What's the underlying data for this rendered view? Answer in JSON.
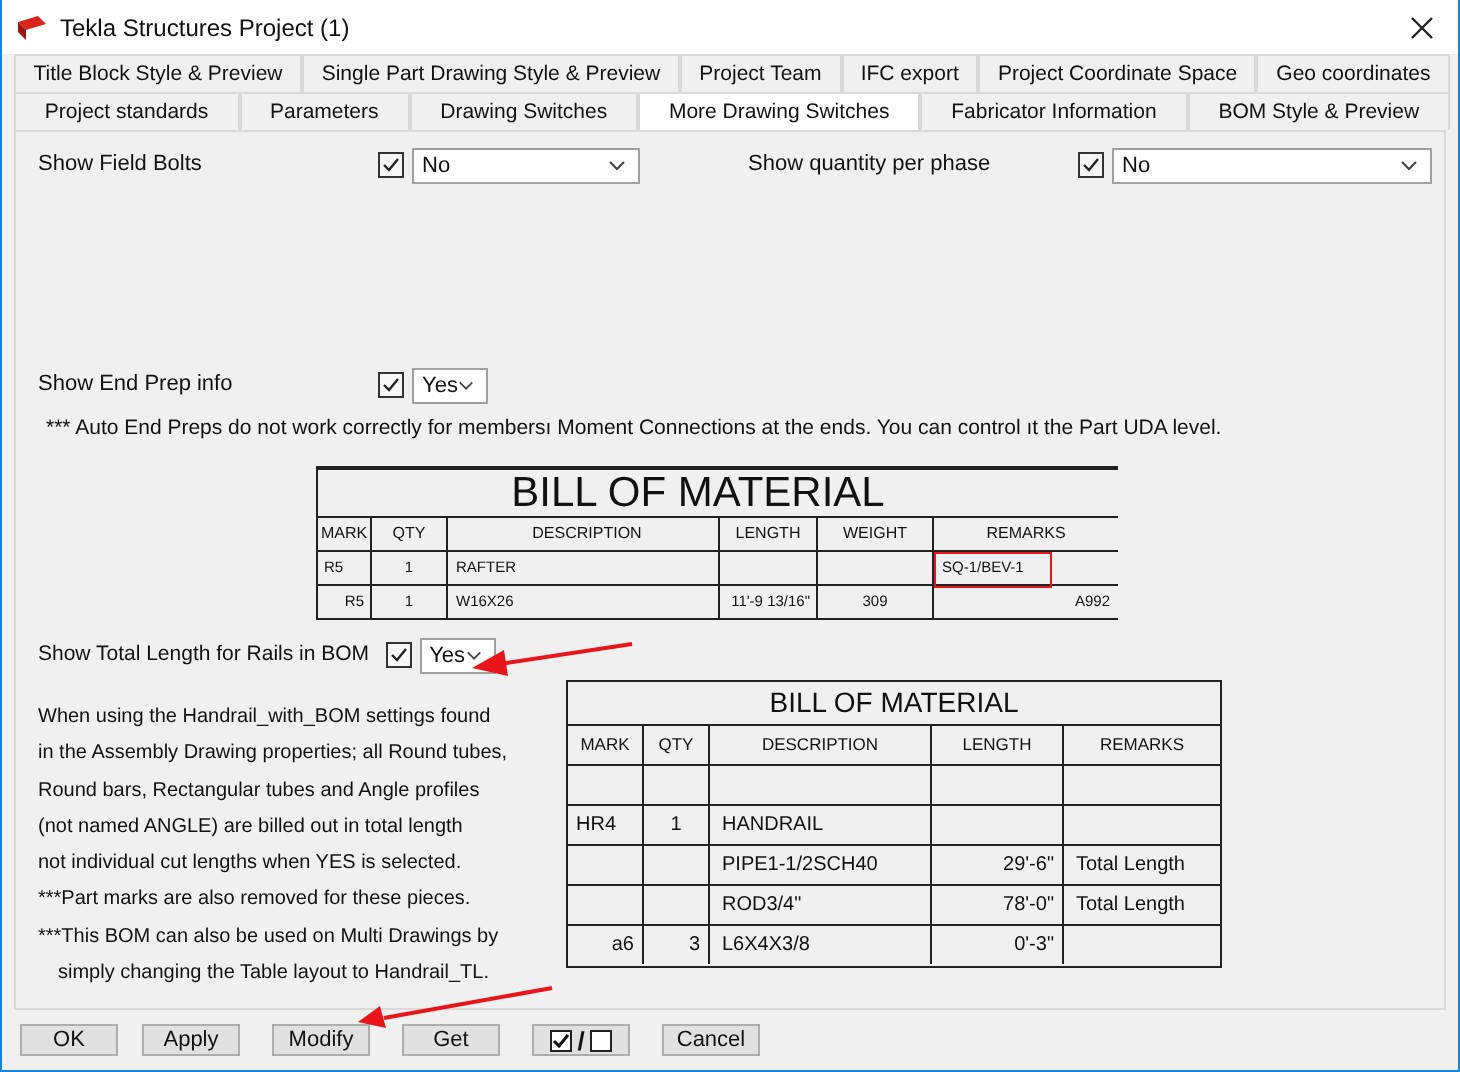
{
  "window": {
    "title": "Tekla Structures  Project (1)"
  },
  "tab_rows": [
    [
      {
        "label": "Title Block Style & Preview",
        "selected": false
      },
      {
        "label": "Single Part Drawing Style & Preview",
        "selected": false
      },
      {
        "label": "Project Team",
        "selected": false
      },
      {
        "label": "IFC export",
        "selected": false
      },
      {
        "label": "Project Coordinate Space",
        "selected": false
      },
      {
        "label": "Geo coordinates",
        "selected": false
      }
    ],
    [
      {
        "label": "Project standards",
        "selected": false
      },
      {
        "label": "Parameters",
        "selected": false
      },
      {
        "label": "Drawing Switches",
        "selected": false
      },
      {
        "label": "More Drawing Switches",
        "selected": true
      },
      {
        "label": "Fabricator Information",
        "selected": false
      },
      {
        "label": "BOM Style & Preview",
        "selected": false
      }
    ]
  ],
  "top_settings": [
    {
      "label": "Show Field Bolts",
      "checked": true,
      "value": "No"
    },
    {
      "label": "Show quantity per phase",
      "checked": true,
      "value": "No"
    }
  ],
  "end_prep": {
    "label": "Show End Prep info",
    "checked": true,
    "value": "Yes",
    "note": "*** Auto End Preps do not work correctly for membersı Moment Connections at the ends. You can control ıt the Part UDA level."
  },
  "bom1": {
    "title": "BILL OF MATERIAL",
    "columns": [
      "MARK",
      "QTY",
      "DESCRIPTION",
      "LENGTH",
      "WEIGHT",
      "REMARKS"
    ],
    "rows": [
      {
        "cells": [
          "R5",
          "1",
          "RAFTER",
          "",
          "",
          "SQ-1/BEV-1"
        ],
        "remark_highlighted": true
      },
      {
        "cells": [
          "R5",
          "1",
          "W16X26",
          "11'-9 13/16\"",
          "309",
          "A992"
        ],
        "remark_highlighted": false
      }
    ]
  },
  "total_length": {
    "label": "Show Total Length for Rails in BOM",
    "checked": true,
    "value": "Yes"
  },
  "explanation": {
    "lines": [
      "When using the Handrail_with_BOM settings found",
      "in the Assembly Drawing properties; all Round tubes,",
      "Round bars, Rectangular tubes and Angle profiles",
      "(not named ANGLE) are billed out in total length",
      "not individual cut lengths when YES is selected.",
      "***Part marks are also removed for these pieces.",
      "***This BOM can also be used on Multi Drawings by"
    ],
    "continuation": "simply changing the Table layout to Handrail_TL."
  },
  "bom2": {
    "title": "BILL OF MATERIAL",
    "columns": [
      "MARK",
      "QTY",
      "DESCRIPTION",
      "LENGTH",
      "REMARKS"
    ],
    "rows": [
      [
        "",
        "",
        "",
        "",
        ""
      ],
      [
        "HR4",
        "1",
        "HANDRAIL",
        "",
        ""
      ],
      [
        "",
        "",
        "PIPE1-1/2SCH40",
        "29'-6\"",
        "Total Length"
      ],
      [
        "",
        "",
        "ROD3/4\"",
        "78'-0\"",
        "Total Length"
      ],
      [
        "a6",
        "3",
        "L6X4X3/8",
        "0'-3\"",
        ""
      ]
    ]
  },
  "buttons": [
    {
      "kind": "text",
      "label": "OK"
    },
    {
      "kind": "text",
      "label": "Apply"
    },
    {
      "kind": "text",
      "label": "Modify"
    },
    {
      "kind": "text",
      "label": "Get"
    },
    {
      "kind": "toggle",
      "label": "/"
    },
    {
      "kind": "text",
      "label": "Cancel"
    }
  ]
}
